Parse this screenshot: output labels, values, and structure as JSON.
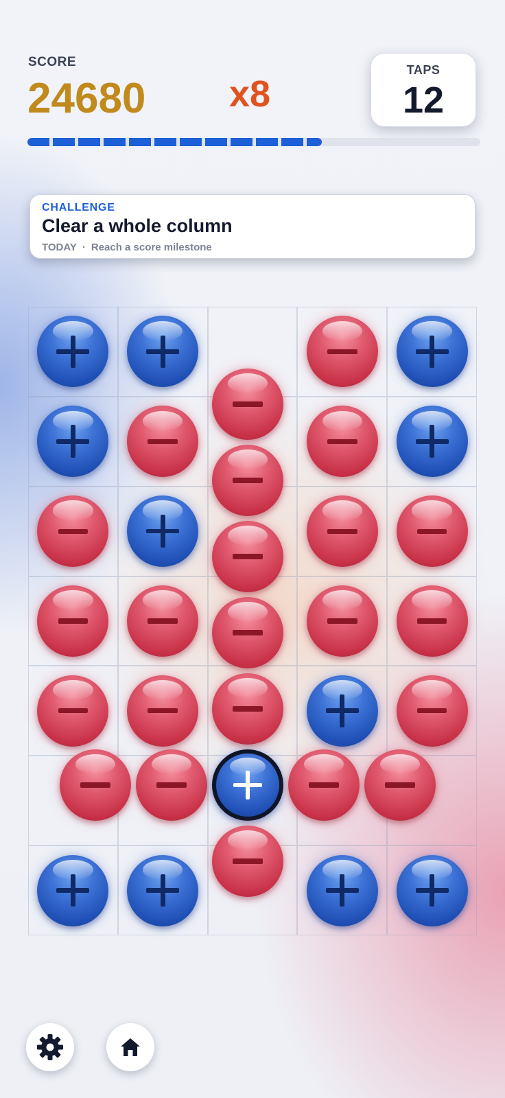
{
  "header": {
    "score_label": "SCORE",
    "score_value": "24680",
    "multiplier": "x8",
    "taps_label": "TAPS",
    "taps_value": "12",
    "progress": 0.65
  },
  "challenge": {
    "label": "CHALLENGE",
    "title": "Clear a whole column",
    "period": "TODAY",
    "separator": "·",
    "subtitle": "Reach a score milestone"
  },
  "board": {
    "columns": 5,
    "rows": 7,
    "balls": [
      [
        "blue",
        "blue",
        null,
        "red",
        "blue"
      ],
      [
        "blue",
        "red",
        null,
        "red",
        "blue"
      ],
      [
        "red",
        "blue",
        null,
        "red",
        "red"
      ],
      [
        "red",
        "red",
        null,
        "red",
        "red"
      ],
      [
        "red",
        "red",
        null,
        "blue",
        "red"
      ],
      [
        null,
        null,
        null,
        null,
        null
      ],
      [
        "blue",
        "blue",
        null,
        "blue",
        "blue"
      ]
    ],
    "center_column": [
      "red",
      "red",
      "red",
      "red",
      "red"
    ],
    "center_row": [
      "red",
      "red",
      "blue",
      "red",
      "red"
    ],
    "center_bottom": "red",
    "selected": "center-row-2"
  },
  "colors": {
    "score": "#c08a1c",
    "multiplier": "#e0531f",
    "accent": "#1d5fd6",
    "red_ball": "#d9455c",
    "blue_ball": "#2d62c8"
  },
  "icons": {
    "settings": "gear-icon",
    "home": "home-icon"
  }
}
